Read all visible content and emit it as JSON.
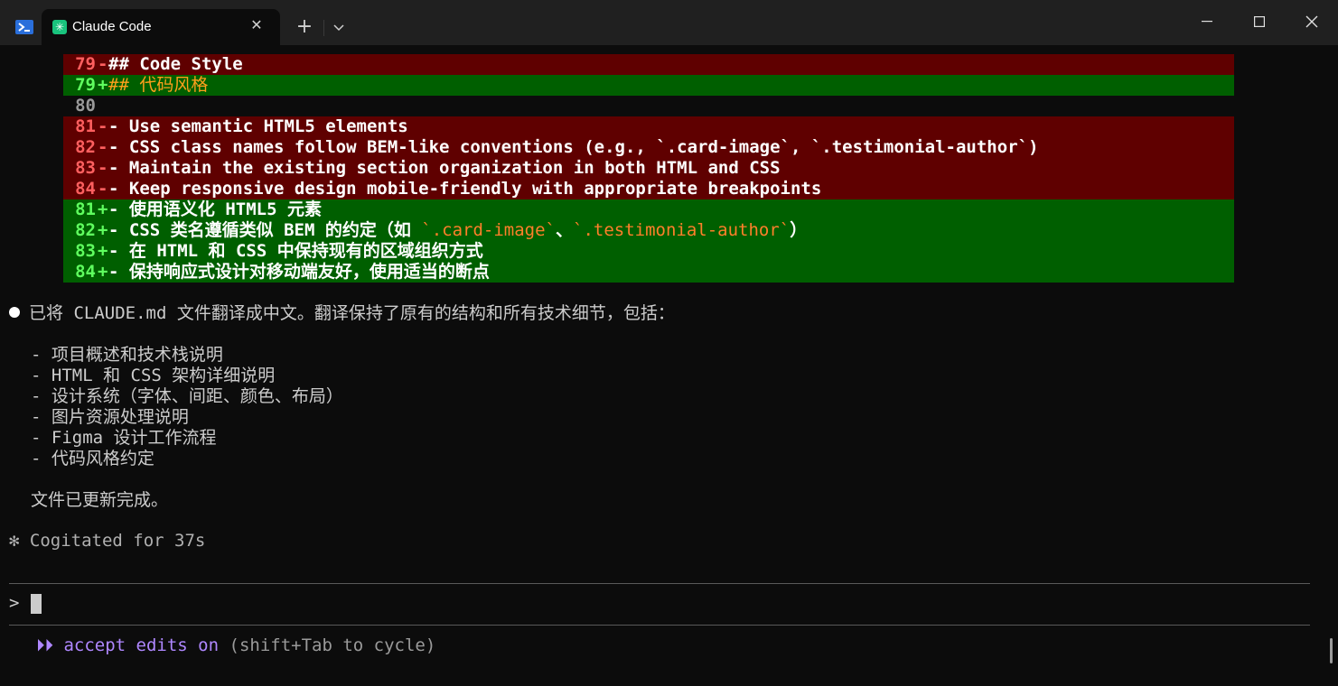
{
  "window": {
    "tab_title": "Claude Code",
    "tab_icon": "claude-asterisk-icon",
    "shell_icon": "powershell-icon"
  },
  "diff": [
    {
      "type": "del",
      "num": "79",
      "mark": "-",
      "text": "## Code Style"
    },
    {
      "type": "add",
      "num": "79",
      "mark": "+",
      "text": "## 代码风格"
    },
    {
      "type": "ctx",
      "num": "80",
      "mark": "",
      "text": ""
    },
    {
      "type": "del",
      "num": "81",
      "mark": "-",
      "text": "- Use semantic HTML5 elements"
    },
    {
      "type": "del",
      "num": "82",
      "mark": "-",
      "text": "- CSS class names follow BEM-like conventions (e.g., `.card-image`, `.testimonial-author`)"
    },
    {
      "type": "del",
      "num": "83",
      "mark": "-",
      "text": "- Maintain the existing section organization in both HTML and CSS"
    },
    {
      "type": "del",
      "num": "84",
      "mark": "-",
      "text": "- Keep responsive design mobile-friendly with appropriate breakpoints"
    },
    {
      "type": "add",
      "num": "81",
      "mark": "+",
      "text": "- 使用语义化 HTML5 元素"
    },
    {
      "type": "add",
      "num": "82",
      "mark": "+",
      "text_parts": [
        "- CSS 类名遵循类似 BEM 的约定（如 ",
        "`.card-image`",
        "、",
        "`.testimonial-author`",
        "）"
      ]
    },
    {
      "type": "add",
      "num": "83",
      "mark": "+",
      "text": "- 在 HTML 和 CSS 中保持现有的区域组织方式"
    },
    {
      "type": "add",
      "num": "84",
      "mark": "+",
      "text": "- 保持响应式设计对移动端友好，使用适当的断点"
    }
  ],
  "message": {
    "summary": "已将 CLAUDE.md 文件翻译成中文。翻译保持了原有的结构和所有技术细节，包括：",
    "items": [
      "- 项目概述和技术栈说明",
      "- HTML 和 CSS 架构详细说明",
      "- 设计系统（字体、间距、颜色、布局）",
      "- 图片资源处理说明",
      "- Figma 设计工作流程",
      "- 代码风格约定"
    ],
    "done": "文件已更新完成。"
  },
  "status": "✻ Cogitated for 37s",
  "prompt_symbol": ">",
  "mode": {
    "arrows": "⏵⏵",
    "label": "accept edits on",
    "hint": "(shift+Tab to cycle)"
  },
  "colors": {
    "del_bg": "#5f0000",
    "add_bg": "#005f00",
    "accent_purple": "#af87ff",
    "code_highlight": "#ff7f2a"
  }
}
